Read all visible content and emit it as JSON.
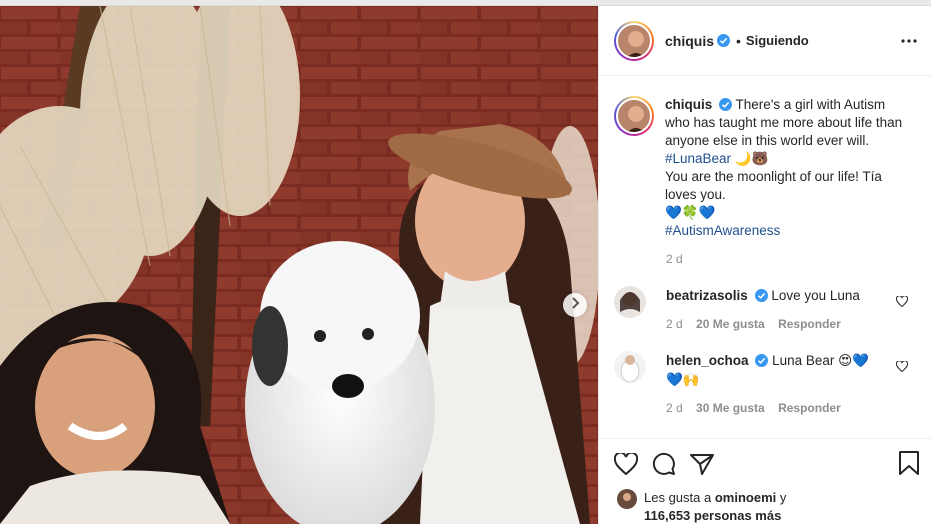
{
  "post": {
    "username": "chiquis",
    "dot": "•",
    "following_label": "Siguiendo"
  },
  "caption": {
    "username": "chiquis",
    "line1": "There's a girl with Autism who has taught me more about life than anyone else in this world ever will.",
    "hashtag1": "#LunaBear",
    "emoji1": "🌙🐻",
    "line2": "You are the moonlight of our life! Tía loves you.",
    "emoji2": "💙🍀💙",
    "hashtag2": "#AutismAwareness",
    "time": "2 d"
  },
  "comments": [
    {
      "username": "beatrizasolis",
      "text": "Love you Luna",
      "time": "2 d",
      "likes": "20 Me gusta",
      "reply": "Responder"
    },
    {
      "username": "helen_ochoa",
      "text": "Luna Bear 😍💙💙🙌",
      "time": "2 d",
      "likes": "30 Me gusta",
      "reply": "Responder"
    }
  ],
  "likes": {
    "prefix": "Les gusta a",
    "user": "ominoemi",
    "connector": "y",
    "count": "116,653 personas más"
  },
  "icons": {
    "verified": "verified-badge-icon",
    "more": "more-options-icon",
    "next": "chevron-right-icon",
    "like": "heart-icon",
    "comment": "comment-icon",
    "share": "share-icon",
    "save": "bookmark-icon"
  },
  "colors": {
    "accent_blue": "#0095f6",
    "hashtag": "#1f4f8f",
    "muted": "#8e8e8e"
  }
}
